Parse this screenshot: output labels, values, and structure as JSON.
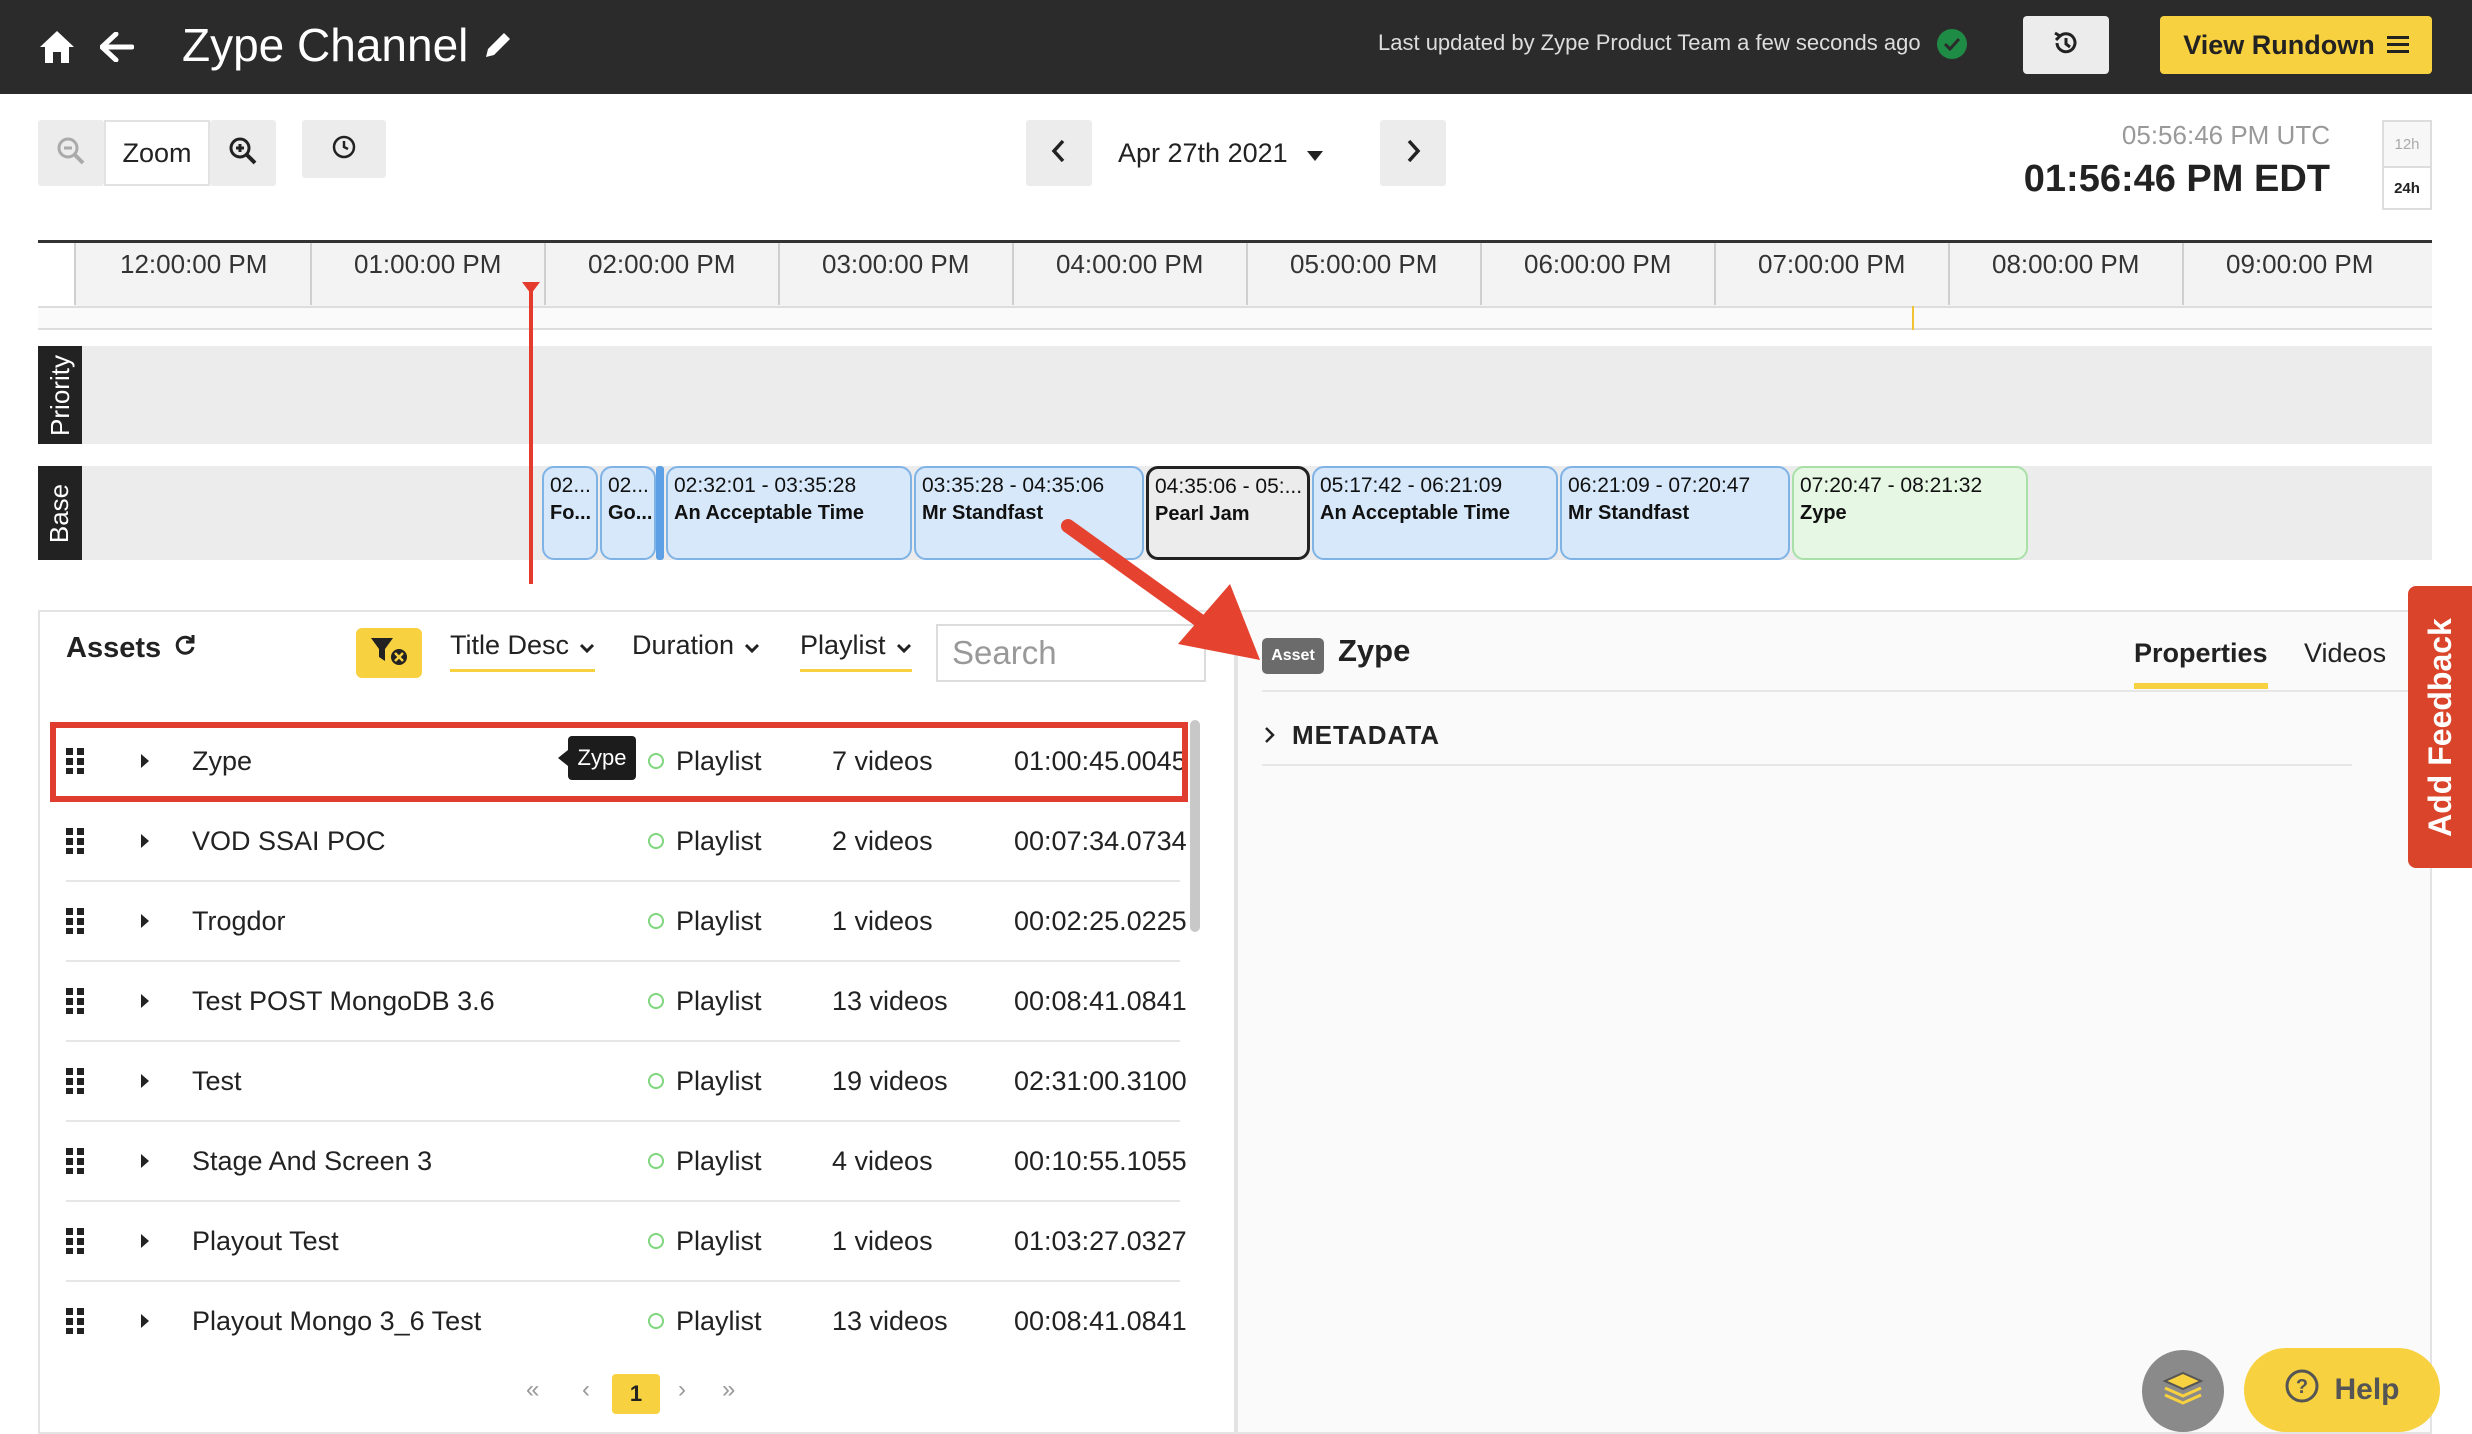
{
  "app": {
    "title": "Zype Channel",
    "last_updated": "Last updated by Zype Product Team a few seconds ago",
    "view_rundown_label": "View Rundown"
  },
  "toolbar": {
    "zoom_label": "Zoom",
    "date_label": "Apr 27th 2021",
    "time_utc": "05:56:46 PM UTC",
    "time_local": "01:56:46 PM EDT",
    "range_12h": "12h",
    "range_24h": "24h"
  },
  "timeline": {
    "ticks": [
      "12:00:00 PM",
      "01:00:00 PM",
      "02:00:00 PM",
      "03:00:00 PM",
      "04:00:00 PM",
      "05:00:00 PM",
      "06:00:00 PM",
      "07:00:00 PM",
      "08:00:00 PM",
      "09:00:00 PM"
    ],
    "tracks": {
      "priority": "Priority",
      "base": "Base"
    },
    "blocks": [
      {
        "time": "02...",
        "name": "Fo..."
      },
      {
        "time": "02...",
        "name": "Go..."
      },
      {
        "time": "02:32:01 - 03:35:28",
        "name": "An Acceptable Time"
      },
      {
        "time": "03:35:28 - 04:35:06",
        "name": "Mr Standfast"
      },
      {
        "time": "04:35:06 - 05:...",
        "name": "Pearl Jam"
      },
      {
        "time": "05:17:42 - 06:21:09",
        "name": "An Acceptable Time"
      },
      {
        "time": "06:21:09 - 07:20:47",
        "name": "Mr Standfast"
      },
      {
        "time": "07:20:47 - 08:21:32",
        "name": "Zype"
      }
    ]
  },
  "assets": {
    "title": "Assets",
    "sort_title": "Title Desc",
    "sort_duration": "Duration",
    "sort_playlist": "Playlist",
    "search_placeholder": "Search",
    "tooltip": "Zype",
    "rows": [
      {
        "name": "Zype",
        "type": "Playlist",
        "count": "7 videos",
        "duration": "01:00:45.0045"
      },
      {
        "name": "VOD SSAI POC",
        "type": "Playlist",
        "count": "2 videos",
        "duration": "00:07:34.0734"
      },
      {
        "name": "Trogdor",
        "type": "Playlist",
        "count": "1 videos",
        "duration": "00:02:25.0225"
      },
      {
        "name": "Test POST MongoDB 3.6",
        "type": "Playlist",
        "count": "13 videos",
        "duration": "00:08:41.0841"
      },
      {
        "name": "Test",
        "type": "Playlist",
        "count": "19 videos",
        "duration": "02:31:00.3100"
      },
      {
        "name": "Stage And Screen 3",
        "type": "Playlist",
        "count": "4 videos",
        "duration": "00:10:55.1055"
      },
      {
        "name": "Playout Test",
        "type": "Playlist",
        "count": "1 videos",
        "duration": "01:03:27.0327"
      },
      {
        "name": "Playout Mongo 3_6 Test",
        "type": "Playlist",
        "count": "13 videos",
        "duration": "00:08:41.0841"
      }
    ],
    "pagination": {
      "first": "«",
      "prev": "‹",
      "page": "1",
      "next": "›",
      "last": "»"
    }
  },
  "detail": {
    "badge": "Asset",
    "name": "Zype",
    "tab_properties": "Properties",
    "tab_videos": "Videos",
    "section_metadata": "METADATA"
  },
  "feedback_label": "Add Feedback",
  "help_label": "Help",
  "colors": {
    "accent": "#f7d13f",
    "topbar": "#2b2b2b",
    "playhead": "#e53b2c",
    "block_blue": "#d6e8fa",
    "block_green": "#e6f8e4",
    "feedback": "#d9442b"
  },
  "icons": [
    "home-icon",
    "back-arrow-icon",
    "pencil-icon",
    "check-circle-icon",
    "history-icon",
    "menu-icon",
    "zoom-out-icon",
    "zoom-in-icon",
    "clock-icon",
    "chevron-left-icon",
    "chevron-right-icon",
    "caret-down-icon",
    "refresh-icon",
    "filter-clear-icon",
    "drag-handle-icon",
    "expand-caret-icon",
    "help-circle-icon",
    "stack-icon"
  ]
}
